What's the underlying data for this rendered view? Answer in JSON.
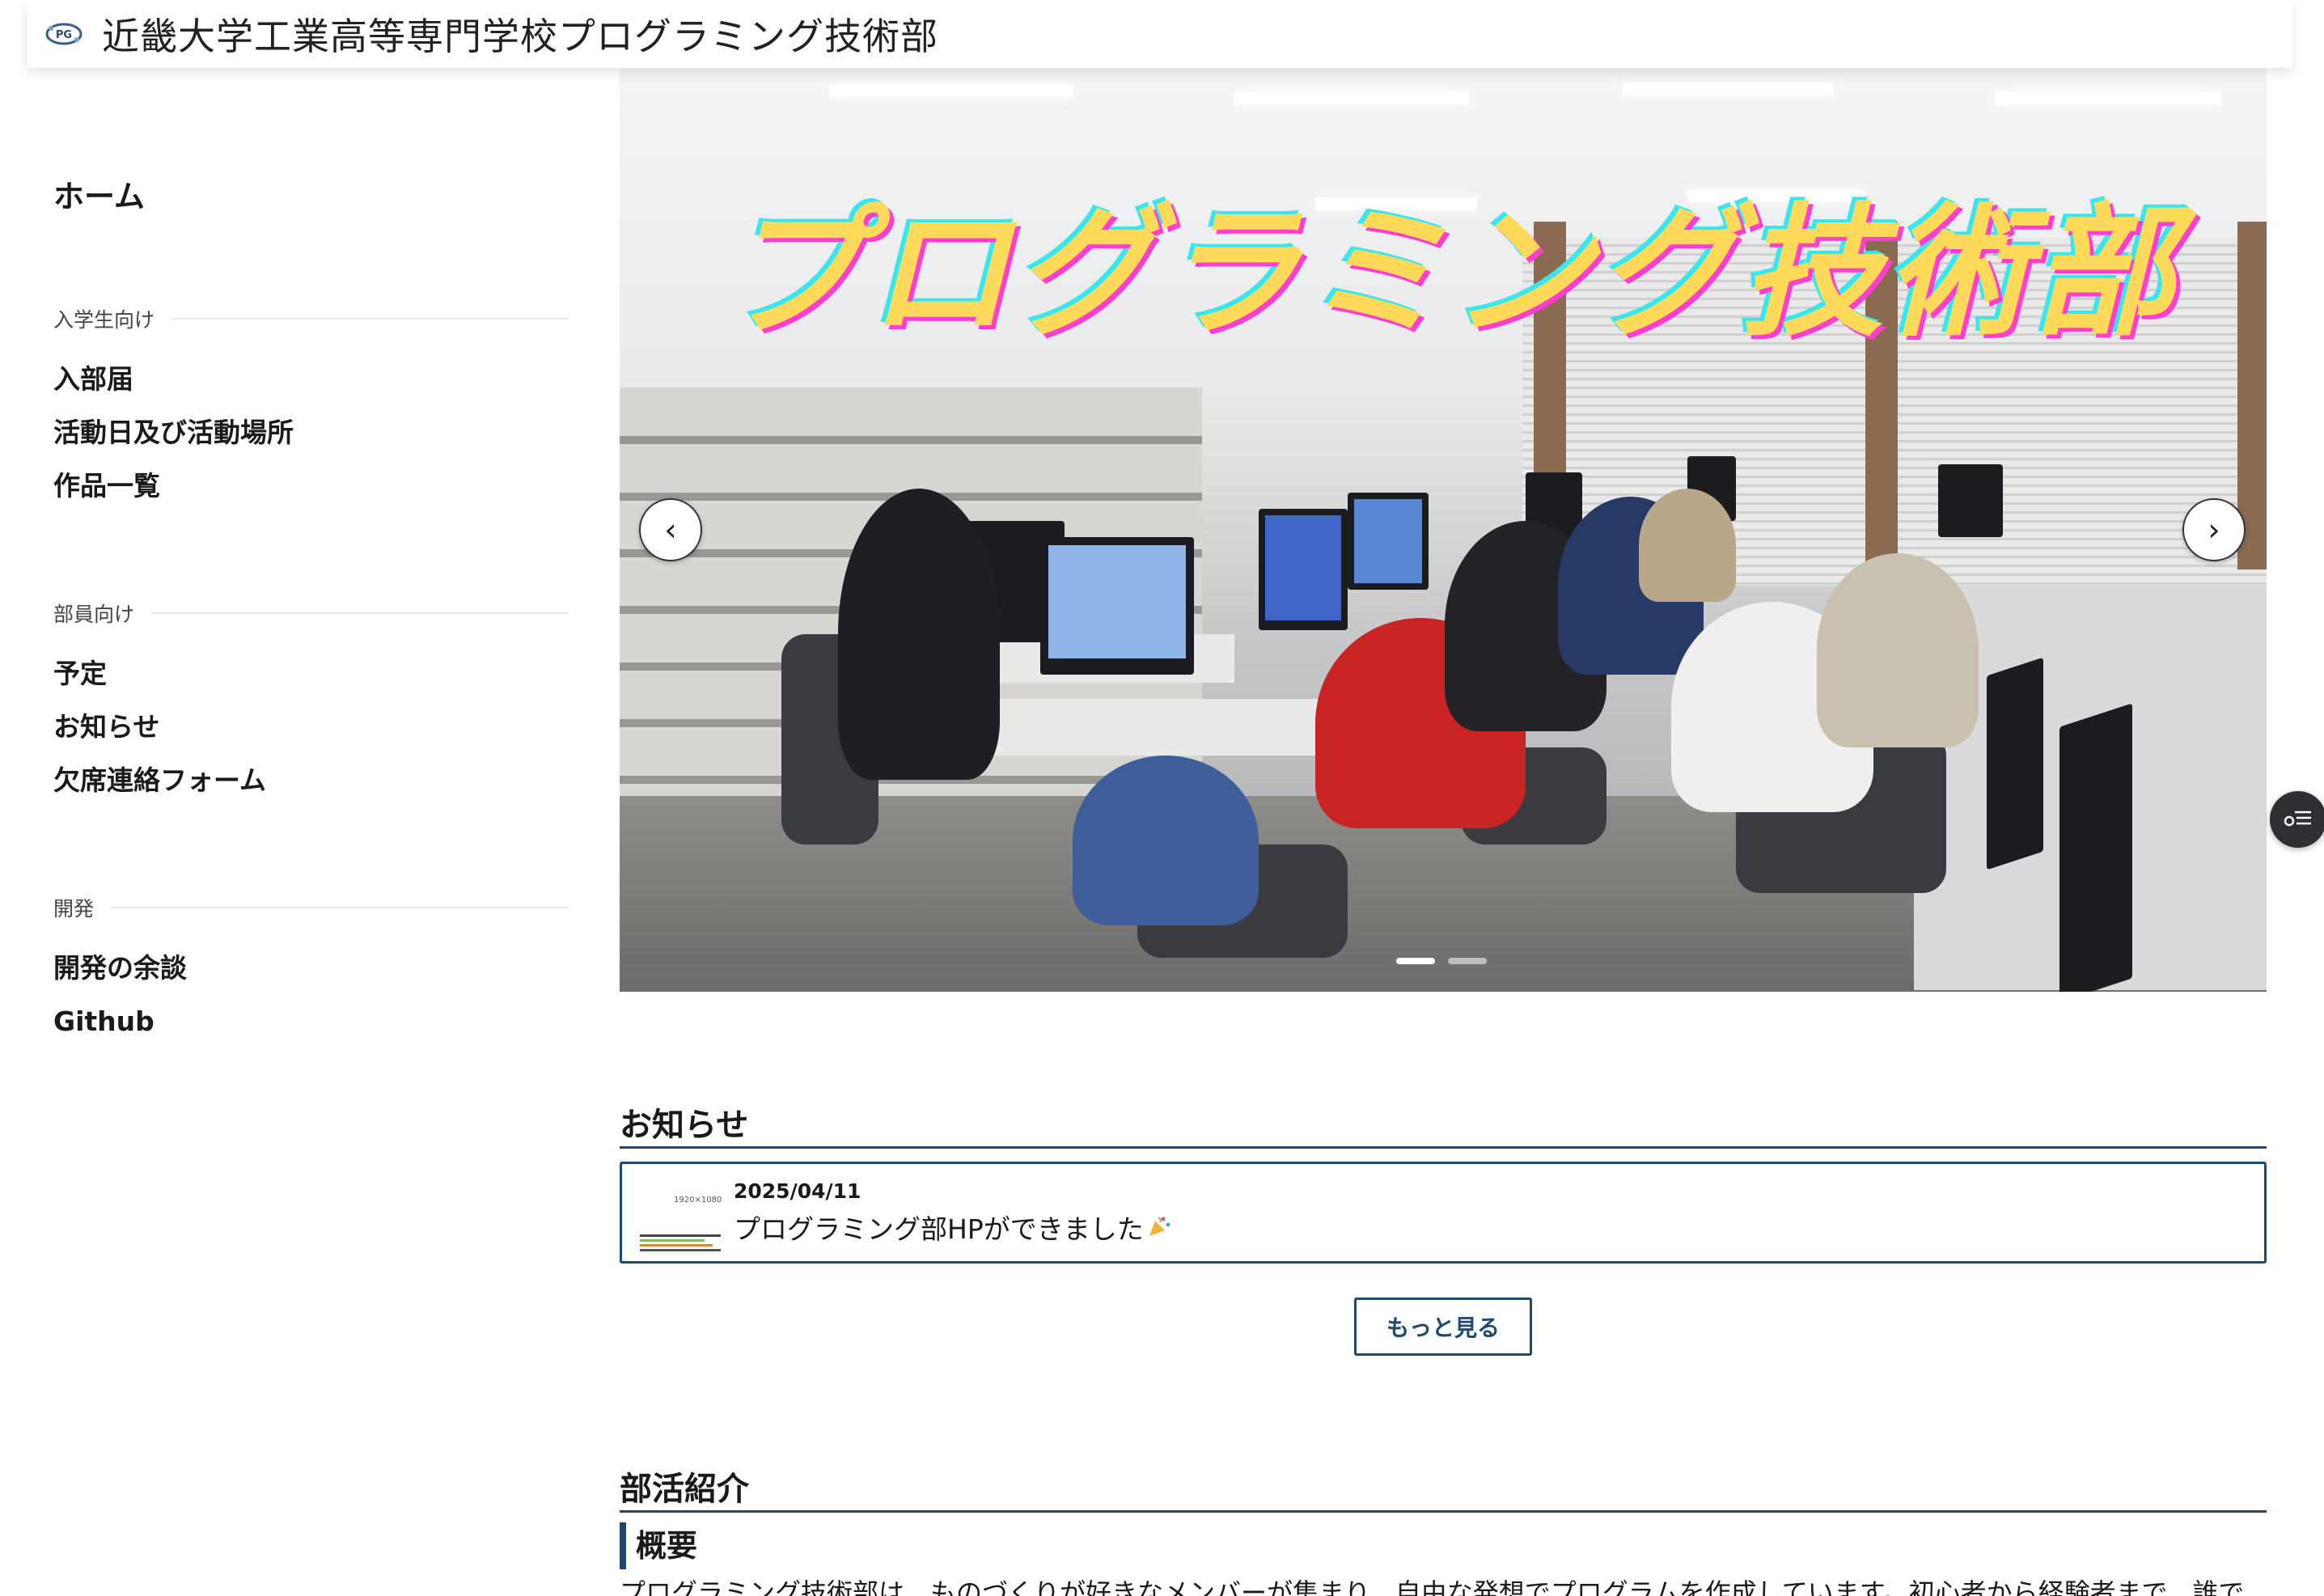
{
  "header": {
    "title": "近畿大学工業高等専門学校プログラミング技術部"
  },
  "sidebar": {
    "home": "ホーム",
    "sections": [
      {
        "heading": "入学生向け",
        "items": [
          "入部届",
          "活動日及び活動場所",
          "作品一覧"
        ]
      },
      {
        "heading": "部員向け",
        "items": [
          "予定",
          "お知らせ",
          "欠席連絡フォーム"
        ]
      },
      {
        "heading": "開発",
        "items": [
          "開発の余談",
          "Github"
        ]
      }
    ]
  },
  "carousel": {
    "title": "プログラミング技術部",
    "prev_label": "‹",
    "next_label": "›",
    "slide_count": 2,
    "active_slide": 0
  },
  "news": {
    "heading": "お知らせ",
    "items": [
      {
        "date": "2025/04/11",
        "headline": "プログラミング部HPができました",
        "thumb_text": "1920×1080"
      }
    ],
    "more_label": "もっと見る"
  },
  "about": {
    "heading": "部活紹介",
    "subheading": "概要",
    "text": "プログラミング技術部は、ものづくりが好きなメンバーが集まり、自由な発想でプログラムを作成しています。初心者から経験者まで、誰で"
  },
  "colors": {
    "accent": "#1e4a72",
    "title_fill": "#ffd95a",
    "title_shadow_pink": "#ff3ecf",
    "title_shadow_cyan": "#37e6ee"
  },
  "icons": {
    "logo": "club-logo-icon",
    "toc": "table-of-contents-icon",
    "prev": "chevron-left-icon",
    "next": "chevron-right-icon"
  }
}
